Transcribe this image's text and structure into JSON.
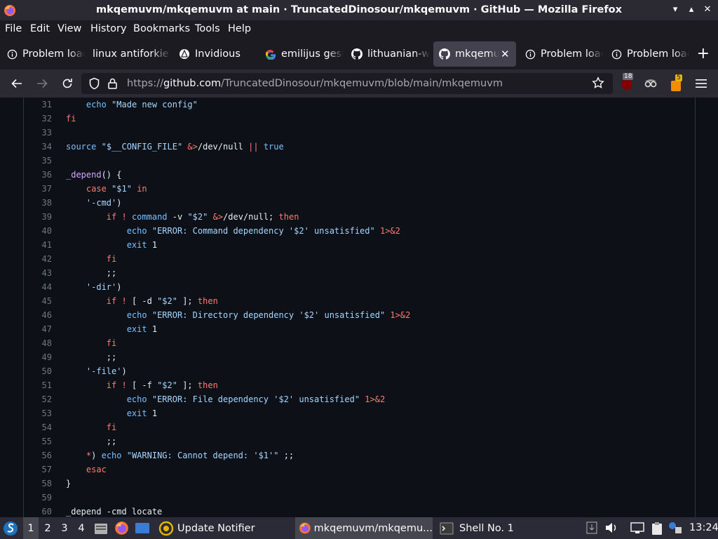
{
  "window": {
    "title": "mkqemuvm/mkqemuvm at main · TruncatedDinosour/mkqemuvm · GitHub — Mozilla Firefox"
  },
  "menu": [
    "File",
    "Edit",
    "View",
    "History",
    "Bookmarks",
    "Tools",
    "Help"
  ],
  "tabs": [
    {
      "label": "Problem loading page",
      "icon": "info-icon"
    },
    {
      "label": "linux antiforkie",
      "icon": "none"
    },
    {
      "label": "Invidious",
      "icon": "invidious-icon"
    },
    {
      "label": "emilijus gest",
      "icon": "google-icon"
    },
    {
      "label": "lithuanian-w",
      "icon": "github-icon"
    },
    {
      "label": "mkqemuvm",
      "icon": "github-icon",
      "active": true
    },
    {
      "label": "Problem loading page",
      "icon": "info-icon"
    },
    {
      "label": "Problem loading page",
      "icon": "info-icon"
    }
  ],
  "url": {
    "scheme": "https://",
    "host": "github.com",
    "path": "/TruncatedDinosour/mkqemuvm/blob/main/mkqemuvm"
  },
  "extensions": {
    "ublock_count": "18",
    "badge_count": "5"
  },
  "code_lines": [
    {
      "n": "31",
      "html": "    <span class=\"b\">echo</span> <span class=\"s\">\"Made new config\"</span>"
    },
    {
      "n": "32",
      "html": "<span class=\"k\">fi</span>"
    },
    {
      "n": "33",
      "html": ""
    },
    {
      "n": "34",
      "html": "<span class=\"b\">source</span> <span class=\"s\">\"$__CONFIG_FILE\"</span> <span class=\"k\">&amp;&gt;</span>/dev/null <span class=\"k\">||</span> <span class=\"b\">true</span>"
    },
    {
      "n": "35",
      "html": ""
    },
    {
      "n": "36",
      "html": "<span class=\"f\">_depend</span>() {"
    },
    {
      "n": "37",
      "html": "    <span class=\"k\">case</span> <span class=\"s\">\"$1\"</span> <span class=\"k\">in</span>"
    },
    {
      "n": "38",
      "html": "    <span class=\"s\">'-cmd'</span>)"
    },
    {
      "n": "39",
      "html": "        <span class=\"k\">if</span> <span class=\"k\">!</span> <span class=\"b\">command</span> -v <span class=\"s\">\"$2\"</span> <span class=\"k\">&amp;&gt;</span>/dev/null; <span class=\"k\">then</span>"
    },
    {
      "n": "40",
      "html": "            <span class=\"b\">echo</span> <span class=\"s\">\"ERROR: Command dependency '$2' unsatisfied\"</span> <span class=\"k\">1&gt;&amp;2</span>"
    },
    {
      "n": "41",
      "html": "            <span class=\"b\">exit</span> 1"
    },
    {
      "n": "42",
      "html": "        <span class=\"k\">fi</span>"
    },
    {
      "n": "43",
      "html": "        ;;"
    },
    {
      "n": "44",
      "html": "    <span class=\"s\">'-dir'</span>)"
    },
    {
      "n": "45",
      "html": "        <span class=\"k\">if</span> <span class=\"k\">!</span> [ -d <span class=\"s\">\"$2\"</span> ]; <span class=\"k\">then</span>"
    },
    {
      "n": "46",
      "html": "            <span class=\"b\">echo</span> <span class=\"s\">\"ERROR: Directory dependency '$2' unsatisfied\"</span> <span class=\"k\">1&gt;&amp;2</span>"
    },
    {
      "n": "47",
      "html": "            <span class=\"b\">exit</span> 1"
    },
    {
      "n": "48",
      "html": "        <span class=\"k\">fi</span>"
    },
    {
      "n": "49",
      "html": "        ;;"
    },
    {
      "n": "50",
      "html": "    <span class=\"s\">'-file'</span>)"
    },
    {
      "n": "51",
      "html": "        <span class=\"k\">if</span> <span class=\"k\">!</span> [ -f <span class=\"s\">\"$2\"</span> ]; <span class=\"k\">then</span>"
    },
    {
      "n": "52",
      "html": "            <span class=\"b\">echo</span> <span class=\"s\">\"ERROR: File dependency '$2' unsatisfied\"</span> <span class=\"k\">1&gt;&amp;2</span>"
    },
    {
      "n": "53",
      "html": "            <span class=\"b\">exit</span> 1"
    },
    {
      "n": "54",
      "html": "        <span class=\"k\">fi</span>"
    },
    {
      "n": "55",
      "html": "        ;;"
    },
    {
      "n": "56",
      "html": "    <span class=\"k\">*</span>) <span class=\"b\">echo</span> <span class=\"s\">\"WARNING: Cannot depend: '$1'\"</span> ;;"
    },
    {
      "n": "57",
      "html": "    <span class=\"k\">esac</span>"
    },
    {
      "n": "58",
      "html": "}"
    },
    {
      "n": "59",
      "html": ""
    },
    {
      "n": "60",
      "html": "_depend -cmd locate"
    }
  ],
  "taskbar": {
    "workspaces": [
      "1",
      "2",
      "3",
      "4"
    ],
    "tasks": [
      {
        "label": "Update Notifier",
        "icon": "update-notifier-icon"
      },
      {
        "label": "mkqemuvm/mkqemu...",
        "icon": "firefox-icon",
        "active": true
      },
      {
        "label": "Shell No. 1",
        "icon": "terminal-icon"
      }
    ],
    "clock": "13:24"
  }
}
